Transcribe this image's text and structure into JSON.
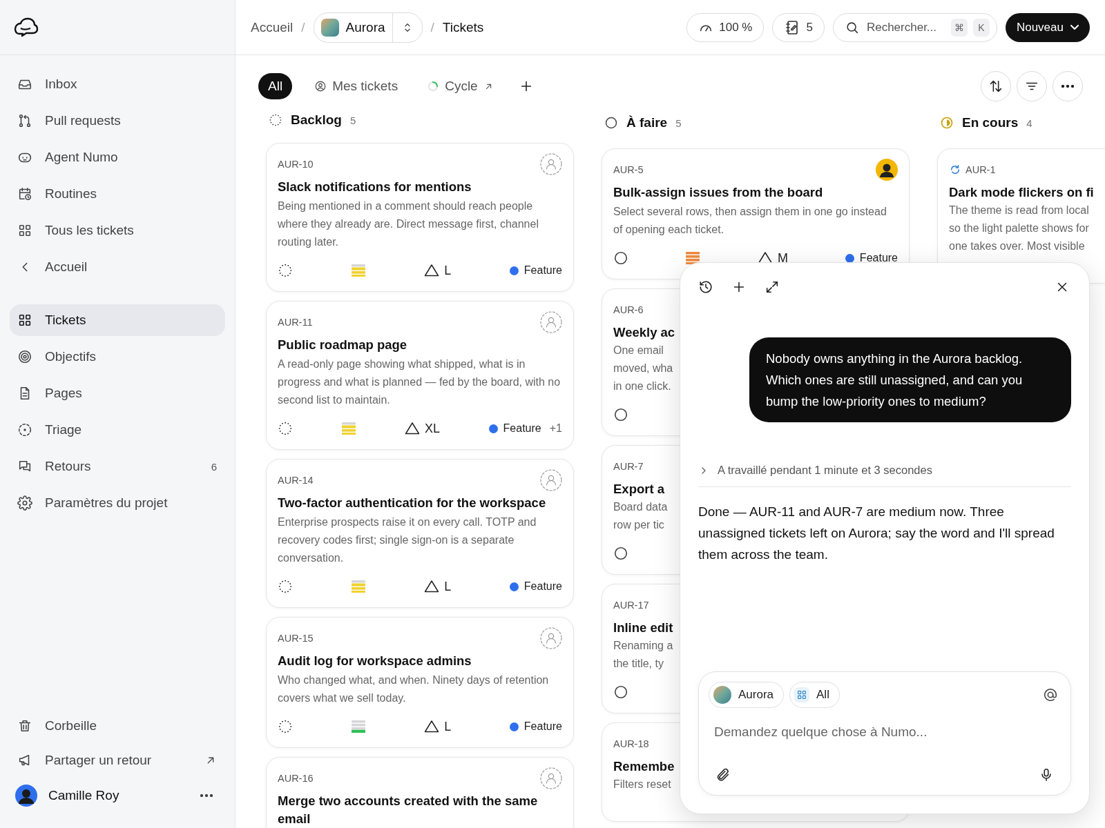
{
  "sidebar": {
    "nav": [
      {
        "label": "Inbox",
        "selected": false
      },
      {
        "label": "Pull requests",
        "selected": false
      },
      {
        "label": "Agent Numo",
        "selected": false
      },
      {
        "label": "Routines",
        "selected": false
      },
      {
        "label": "Tous les tickets",
        "selected": false
      },
      {
        "label": "Accueil",
        "selected": false
      }
    ],
    "project_nav": [
      {
        "label": "Tickets",
        "selected": true
      },
      {
        "label": "Objectifs",
        "selected": false
      },
      {
        "label": "Pages",
        "selected": false
      },
      {
        "label": "Triage",
        "selected": false
      },
      {
        "label": "Retours",
        "selected": false,
        "badge": "6"
      },
      {
        "label": "Paramètres du projet",
        "selected": false
      }
    ],
    "footer": [
      {
        "label": "Corbeille",
        "external": false
      },
      {
        "label": "Partager un retour",
        "external": true
      }
    ],
    "user": {
      "name": "Camille Roy"
    }
  },
  "breadcrumb": {
    "root": "Accueil",
    "separators": [
      "/",
      "/"
    ],
    "project": "Aurora",
    "page": "Tickets"
  },
  "toolbar": {
    "zoom": "100 %",
    "notes": "5",
    "search_placeholder": "Rechercher...",
    "shortcut": [
      "⌘",
      "K"
    ],
    "new_button": "Nouveau"
  },
  "views": [
    {
      "label": "All",
      "selected": true
    },
    {
      "label": "Mes tickets",
      "selected": false
    },
    {
      "label": "Cycle",
      "selected": false
    }
  ],
  "columns": [
    {
      "title": "Backlog",
      "count": "5",
      "kind": "backlog",
      "cards": [
        {
          "kind": "full",
          "id": "AUR-10",
          "cycle": false,
          "assigned": false,
          "title": "Slack notifications for mentions",
          "description": "Being mentioned in a comment should reach people where they already are. Direct message first, channel routing later.",
          "priority": {
            "kind": "medium"
          },
          "estimate": "L",
          "label": {
            "name": "Feature",
            "color": "#2f6fed"
          }
        },
        {
          "kind": "full",
          "id": "AUR-11",
          "cycle": false,
          "assigned": false,
          "title": "Public roadmap page",
          "description": "A read-only page showing what shipped, what is in progress and what is planned — fed by the board, with no second list to maintain.",
          "priority": {
            "kind": "medium"
          },
          "estimate": "XL",
          "label": {
            "name": "Feature",
            "color": "#2f6fed"
          },
          "extra_labels": "+1"
        },
        {
          "kind": "full",
          "id": "AUR-14",
          "cycle": false,
          "assigned": false,
          "title": "Two-factor authentication for the workspace",
          "description": "Enterprise prospects raise it on every call. TOTP and recovery codes first; single sign-on is a separate conversation.",
          "priority": {
            "kind": "medium"
          },
          "estimate": "L",
          "label": {
            "name": "Feature",
            "color": "#2f6fed"
          }
        },
        {
          "kind": "full",
          "id": "AUR-15",
          "cycle": false,
          "assigned": false,
          "title": "Audit log for workspace admins",
          "description": "Who changed what, and when. Ninety days of retention covers what we sell today.",
          "priority": {
            "kind": "low"
          },
          "estimate": "L",
          "label": {
            "name": "Feature",
            "color": "#2f6fed"
          }
        },
        {
          "kind": "top",
          "id": "AUR-16",
          "cycle": false,
          "assigned": false,
          "title": "Merge two accounts created with the same email"
        }
      ]
    },
    {
      "title": "À faire",
      "count": "5",
      "kind": "todo",
      "cards": [
        {
          "kind": "full",
          "id": "AUR-5",
          "cycle": false,
          "assigned": true,
          "title": "Bulk-assign issues from the board",
          "description": "Select several rows, then assign them in one go instead of opening each ticket.",
          "priority": {
            "kind": "high"
          },
          "estimate": "M",
          "label": {
            "name": "Feature",
            "color": "#2f6fed"
          }
        },
        {
          "kind": "narrow",
          "id": "AUR-6",
          "cycle": false,
          "title": "Weekly ac",
          "lines": [
            "One email",
            "moved, wha",
            "in one click."
          ]
        },
        {
          "kind": "narrow",
          "id": "AUR-7",
          "cycle": false,
          "title": "Export a",
          "lines": [
            "Board data",
            "row per tic"
          ]
        },
        {
          "kind": "narrow",
          "id": "AUR-17",
          "cycle": false,
          "title": "Inline edit",
          "lines": [
            "Renaming a",
            "the title, ty"
          ]
        },
        {
          "kind": "top",
          "id": "AUR-18",
          "cycle": false,
          "title": "Remembe",
          "lines": [
            "Filters reset"
          ]
        }
      ]
    },
    {
      "title": "En cours",
      "count": "4",
      "kind": "in_progress",
      "cards": [
        {
          "kind": "top",
          "id": "AUR-1",
          "cycle": true,
          "title": "Dark mode flickers on fi",
          "lines": [
            "The theme is read from local",
            "so the light palette shows for",
            "one takes over. Most visible"
          ]
        }
      ]
    }
  ],
  "assistant": {
    "message": "Nobody owns anything in the Aurora backlog. Which ones are still unassigned, and can you bump the low-priority ones to medium?",
    "work_note": "A travaillé pendant 1 minute et 3 secondes",
    "reply": "Done — AUR-11 and AUR-7 are medium now. Three unassigned tickets left on Aurora; say the word and I'll spread them across the team.",
    "chips": [
      {
        "label": "Aurora"
      },
      {
        "label": "All"
      }
    ],
    "placeholder": "Demandez quelque chose à Numo..."
  }
}
